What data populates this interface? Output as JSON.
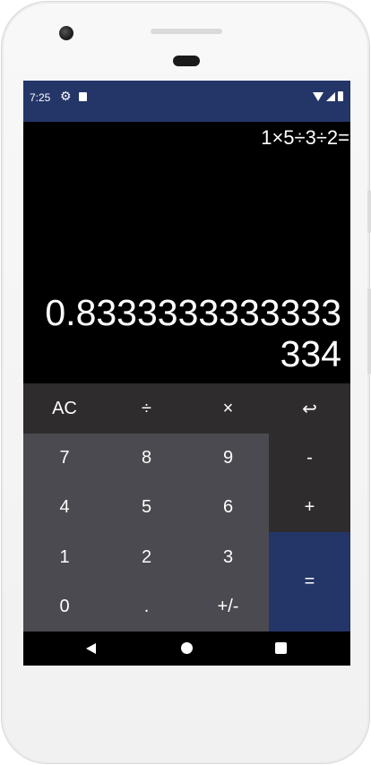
{
  "status_bar": {
    "time": "7:25"
  },
  "display": {
    "expression": "1×5÷3÷2=",
    "result": "0.8333333333333334"
  },
  "keys": {
    "row1": [
      "AC",
      "÷",
      "×",
      "↩"
    ],
    "row2": [
      "7",
      "8",
      "9",
      "-"
    ],
    "row3": [
      "4",
      "5",
      "6",
      "+"
    ],
    "row4": [
      "1",
      "2",
      "3"
    ],
    "row5": [
      "0",
      ".",
      "+/-"
    ],
    "equals": "="
  },
  "colors": {
    "status_bar": "#243568",
    "top_row": "#2e2c2c",
    "number_keys": "#4a4a50",
    "operator_keys": "#2e2c2c",
    "equals_key": "#243568",
    "display_background": "#000000"
  },
  "icons": {
    "status": [
      "gear-icon",
      "sim-card-icon",
      "wifi-icon",
      "signal-icon",
      "battery-icon"
    ],
    "nav": [
      "back-icon",
      "home-icon",
      "recents-icon"
    ]
  }
}
